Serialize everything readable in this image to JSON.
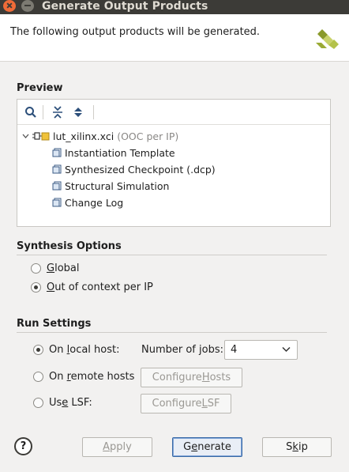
{
  "window": {
    "title": "Generate Output Products"
  },
  "header": {
    "message": "The following output products will be generated."
  },
  "preview": {
    "title": "Preview",
    "toolbar": [
      "search-icon",
      "collapse-all-icon",
      "expand-all-icon"
    ],
    "root": {
      "label": "lut_xilinx.xci",
      "note": "(OOC per IP)"
    },
    "children": [
      "Instantiation Template",
      "Synthesized Checkpoint (.dcp)",
      "Structural Simulation",
      "Change Log"
    ]
  },
  "synthesis": {
    "title": "Synthesis Options",
    "options": [
      {
        "mnemonic": "G",
        "rest": "lobal",
        "checked": false
      },
      {
        "mnemonic": "O",
        "rest": "ut of context per IP",
        "checked": true
      }
    ]
  },
  "run": {
    "title": "Run Settings",
    "local": {
      "pre": "On ",
      "mnemonic": "l",
      "post": "ocal host:",
      "checked": true
    },
    "jobs_label": "Number of jobs:",
    "jobs_value": "4",
    "remote": {
      "pre": "On ",
      "mnemonic": "r",
      "post": "emote hosts",
      "checked": false
    },
    "remote_button": {
      "pre": "Configure ",
      "mnemonic": "H",
      "post": "osts"
    },
    "lsf": {
      "pre": "Us",
      "mnemonic": "e",
      "post": " LSF:",
      "checked": false
    },
    "lsf_button": {
      "pre": "Configure ",
      "mnemonic": "L",
      "post": "SF"
    }
  },
  "buttons": {
    "help": "?",
    "apply": {
      "mnemonic": "A",
      "rest": "pply"
    },
    "generate": {
      "pre": "G",
      "mnemonic": "e",
      "post": "nerate"
    },
    "skip": {
      "pre": "S",
      "mnemonic": "k",
      "post": "ip"
    }
  },
  "colors": {
    "titlebar": "#3c3b37",
    "close": "#ef6b38",
    "accent": "#3a6aa6",
    "logo_light": "#c9d26a",
    "logo_dark": "#8a9a2a"
  }
}
